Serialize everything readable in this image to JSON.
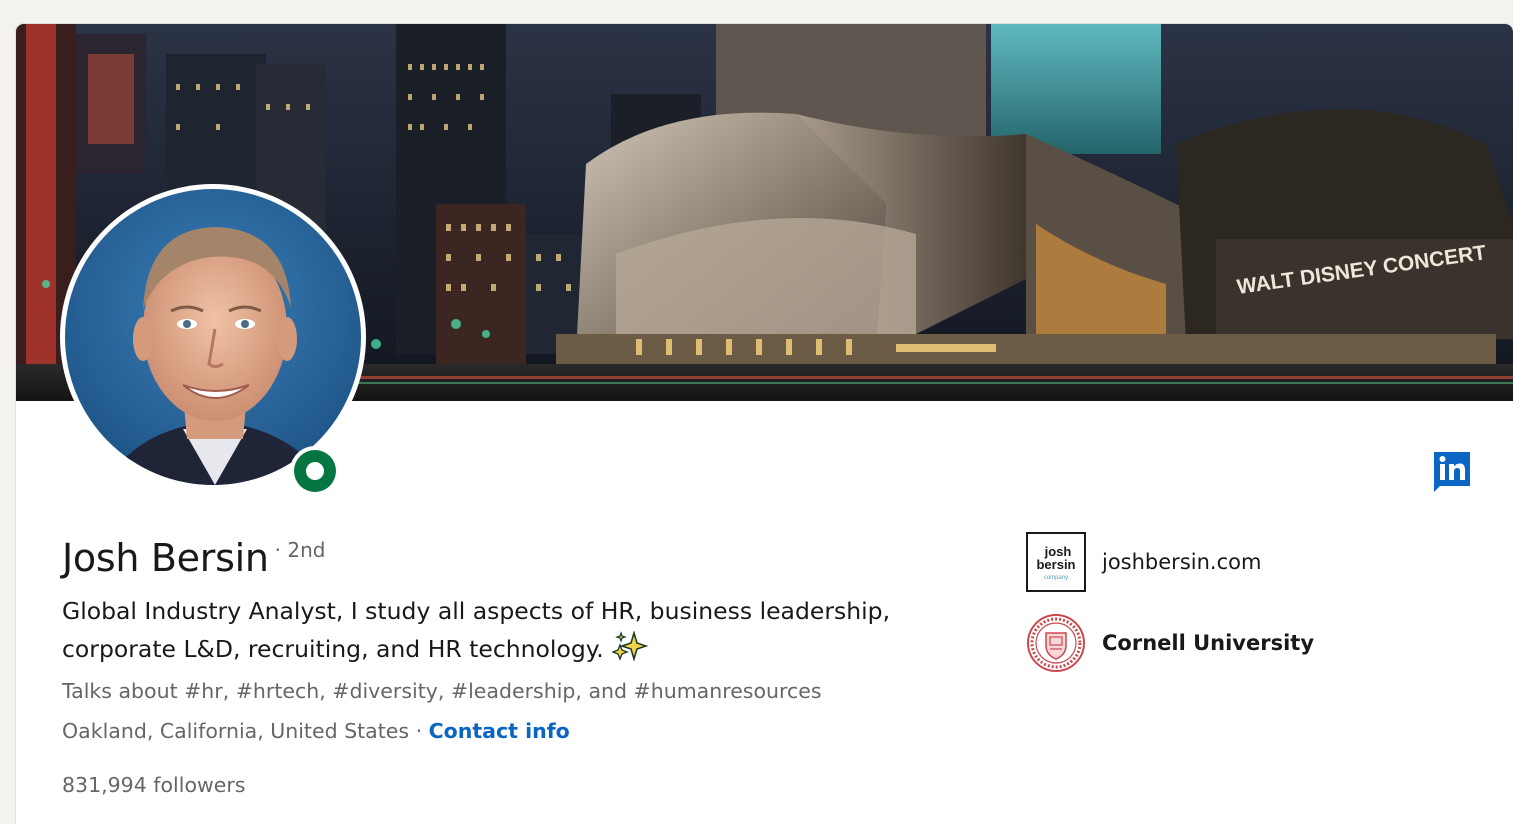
{
  "profile": {
    "name": "Josh Bersin",
    "degree": "· 2nd",
    "headline": "Global Industry Analyst, I study all aspects of HR, business leadership, corporate L&D, recruiting, and HR technology.",
    "talks_about": "Talks about #hr, #hrtech, #diversity, #leadership, and #humanresources",
    "location": "Oakland, California, United States",
    "location_separator": " · ",
    "contact_info_label": "Contact info",
    "followers_count": "831,994",
    "followers_label": " followers",
    "online_status": "online"
  },
  "banner": {
    "sign_text": "WALT DISNEY CONCERT",
    "icon": "concert-hall-photo"
  },
  "experience_links": [
    {
      "label": "joshbersin.com",
      "icon": "josh-bersin-company-logo",
      "logo_text": [
        "josh",
        "bersin",
        "company"
      ]
    },
    {
      "label": "Cornell University",
      "icon": "cornell-university-seal"
    }
  ],
  "actions": {
    "linkedin_icon": "linkedin-icon"
  },
  "colors": {
    "link": "#0a66c2",
    "online": "#057642",
    "text_primary": "#191919",
    "text_secondary": "#666666",
    "background": "#f3f2ef"
  }
}
